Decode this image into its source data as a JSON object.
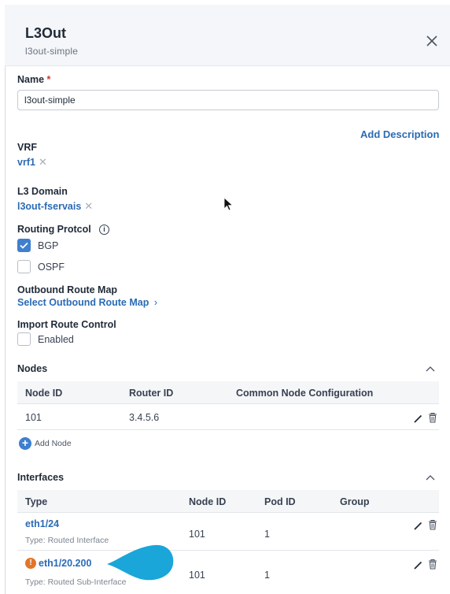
{
  "header": {
    "title": "L3Out",
    "subtitle": "l3out-simple"
  },
  "name": {
    "label": "Name",
    "required_mark": "*",
    "value": "l3out-simple"
  },
  "add_description": "Add Description",
  "vrf": {
    "label": "VRF",
    "value": "vrf1"
  },
  "l3_domain": {
    "label": "L3 Domain",
    "value": "l3out-fservais"
  },
  "routing_protocol": {
    "label": "Routing Protcol",
    "options": [
      {
        "label": "BGP",
        "checked": true
      },
      {
        "label": "OSPF",
        "checked": false
      }
    ]
  },
  "outbound_route_map": {
    "label": "Outbound Route Map",
    "link": "Select Outbound Route Map"
  },
  "import_route_control": {
    "label": "Import Route Control",
    "option": "Enabled"
  },
  "nodes": {
    "title": "Nodes",
    "columns": [
      "Node ID",
      "Router ID",
      "Common Node Configuration"
    ],
    "rows": [
      {
        "node_id": "101",
        "router_id": "3.4.5.6",
        "common": ""
      }
    ],
    "add_label": "Add Node"
  },
  "interfaces": {
    "title": "Interfaces",
    "columns": [
      "Type",
      "Node ID",
      "Pod ID",
      "Group"
    ],
    "rows": [
      {
        "name": "eth1/24",
        "type_text": "Type: Routed Interface",
        "node_id": "101",
        "pod_id": "1",
        "group": ""
      },
      {
        "name": "eth1/20.200",
        "type_text": "Type: Routed Sub-Interface",
        "node_id": "101",
        "pod_id": "1",
        "group": "",
        "warning": true
      }
    ]
  },
  "colors": {
    "accent": "#3f7fd0",
    "link": "#2a6bb5",
    "warning": "#e0762b",
    "bubble": "#1aa6d9"
  }
}
